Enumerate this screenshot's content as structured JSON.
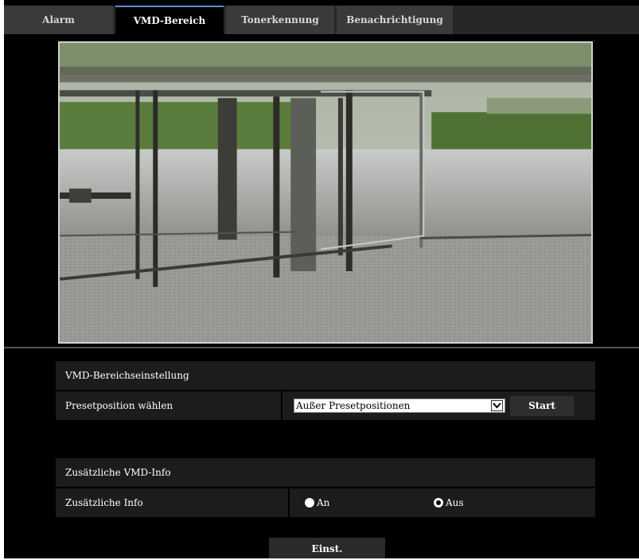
{
  "tabs": [
    {
      "label": "Alarm",
      "active": false
    },
    {
      "label": "VMD-Bereich",
      "active": true
    },
    {
      "label": "Tonerkennung",
      "active": false
    },
    {
      "label": "Benachrichtigung",
      "active": false
    }
  ],
  "vmd_settings": {
    "heading": "VMD-Bereichseinstellung",
    "preset_label": "Presetposition wählen",
    "preset_selected": "Außer Presetpositionen",
    "start_label": "Start"
  },
  "additional_info": {
    "heading": "Zusätzliche VMD-Info",
    "info_label": "Zusätzliche Info",
    "option_on": "An",
    "option_off": "Aus",
    "selected": "Aus"
  },
  "submit_label": "Einst.",
  "colors": {
    "background": "#000000",
    "tab_inactive": "#3a3a3a",
    "tab_active_border": "#5a8fd4",
    "row_background": "#1c1c1c"
  },
  "icons": {
    "dropdown": "chevron-down-icon"
  }
}
